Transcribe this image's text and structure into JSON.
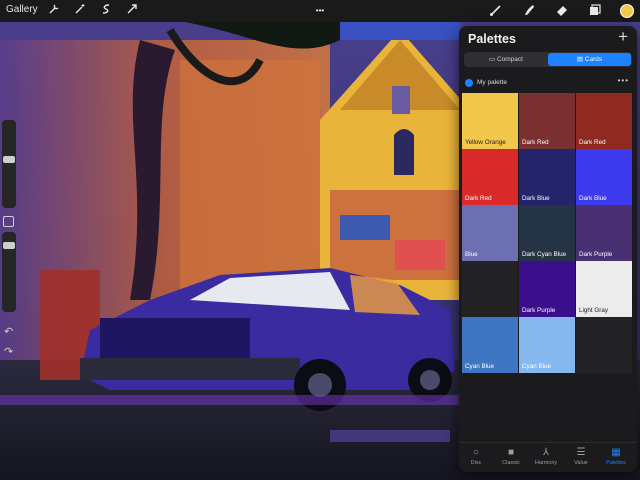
{
  "topbar": {
    "gallery_label": "Gallery",
    "more_label": "•••",
    "color_swatch": "#f2c94c"
  },
  "icons": {
    "wrench": "wrench-icon",
    "magic": "magic-wand-icon",
    "selection": "selection-icon",
    "transform": "transform-arrow-icon",
    "brush": "brush-icon",
    "smudge": "smudge-icon",
    "eraser": "eraser-icon",
    "layers": "layers-icon"
  },
  "sidebar": {
    "undo": "↶",
    "redo": "↷"
  },
  "panel": {
    "title": "Palettes",
    "add": "+",
    "view_compact": "Compact",
    "view_cards": "Cards",
    "palette_name": "My palette",
    "more": "•••",
    "swatches": [
      {
        "name": "Yellow Orange",
        "color": "#f3c64c",
        "light": true
      },
      {
        "name": "Dark Red",
        "color": "#7a3030",
        "light": false
      },
      {
        "name": "Dark Red",
        "color": "#8e2a22",
        "light": false
      },
      {
        "name": "Dark Red",
        "color": "#d82a2a",
        "light": false
      },
      {
        "name": "Dark Blue",
        "color": "#24246a",
        "light": false
      },
      {
        "name": "Dark Blue",
        "color": "#3d3aef",
        "light": false
      },
      {
        "name": "Blue",
        "color": "#6c70b0",
        "light": false
      },
      {
        "name": "Dark Cyan Blue",
        "color": "#253444",
        "light": false
      },
      {
        "name": "Dark Purple",
        "color": "#493072",
        "light": false
      },
      {
        "name": "Dark Purple",
        "color": "#3b0e8c",
        "light": false
      },
      {
        "name": "Light Gray",
        "color": "#ececec",
        "light": true
      },
      {
        "name": "Cyan Blue",
        "color": "#3f76c4",
        "light": false
      },
      {
        "name": "Cyan Blue",
        "color": "#86b8f0",
        "light": false
      }
    ],
    "tabs": [
      "Disc",
      "Classic",
      "Harmony",
      "Value",
      "Palettes"
    ]
  }
}
